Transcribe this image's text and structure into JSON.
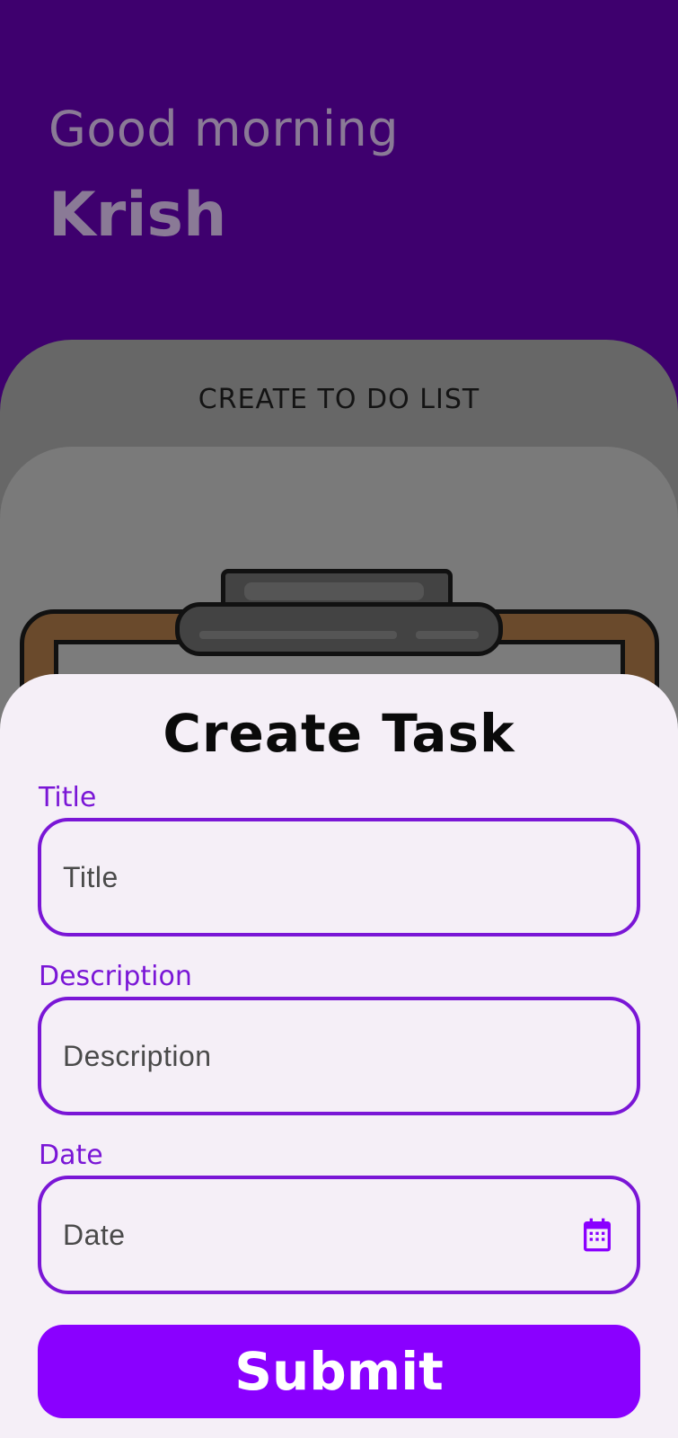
{
  "header": {
    "greeting": "Good morning",
    "username": "Krish"
  },
  "card": {
    "title": "CREATE TO DO LIST",
    "illustration": "clipboard"
  },
  "sheet": {
    "title": "Create Task",
    "fields": {
      "title": {
        "label": "Title",
        "placeholder": "Title",
        "value": ""
      },
      "description": {
        "label": "Description",
        "placeholder": "Description",
        "value": ""
      },
      "date": {
        "label": "Date",
        "placeholder": "Date",
        "value": "",
        "icon": "calendar-icon"
      }
    },
    "submit_label": "Submit"
  },
  "colors": {
    "header_bg": "#3e006e",
    "accent": "#8a00ff",
    "field_border": "#7a16d6",
    "sheet_bg": "#f5eff7"
  }
}
